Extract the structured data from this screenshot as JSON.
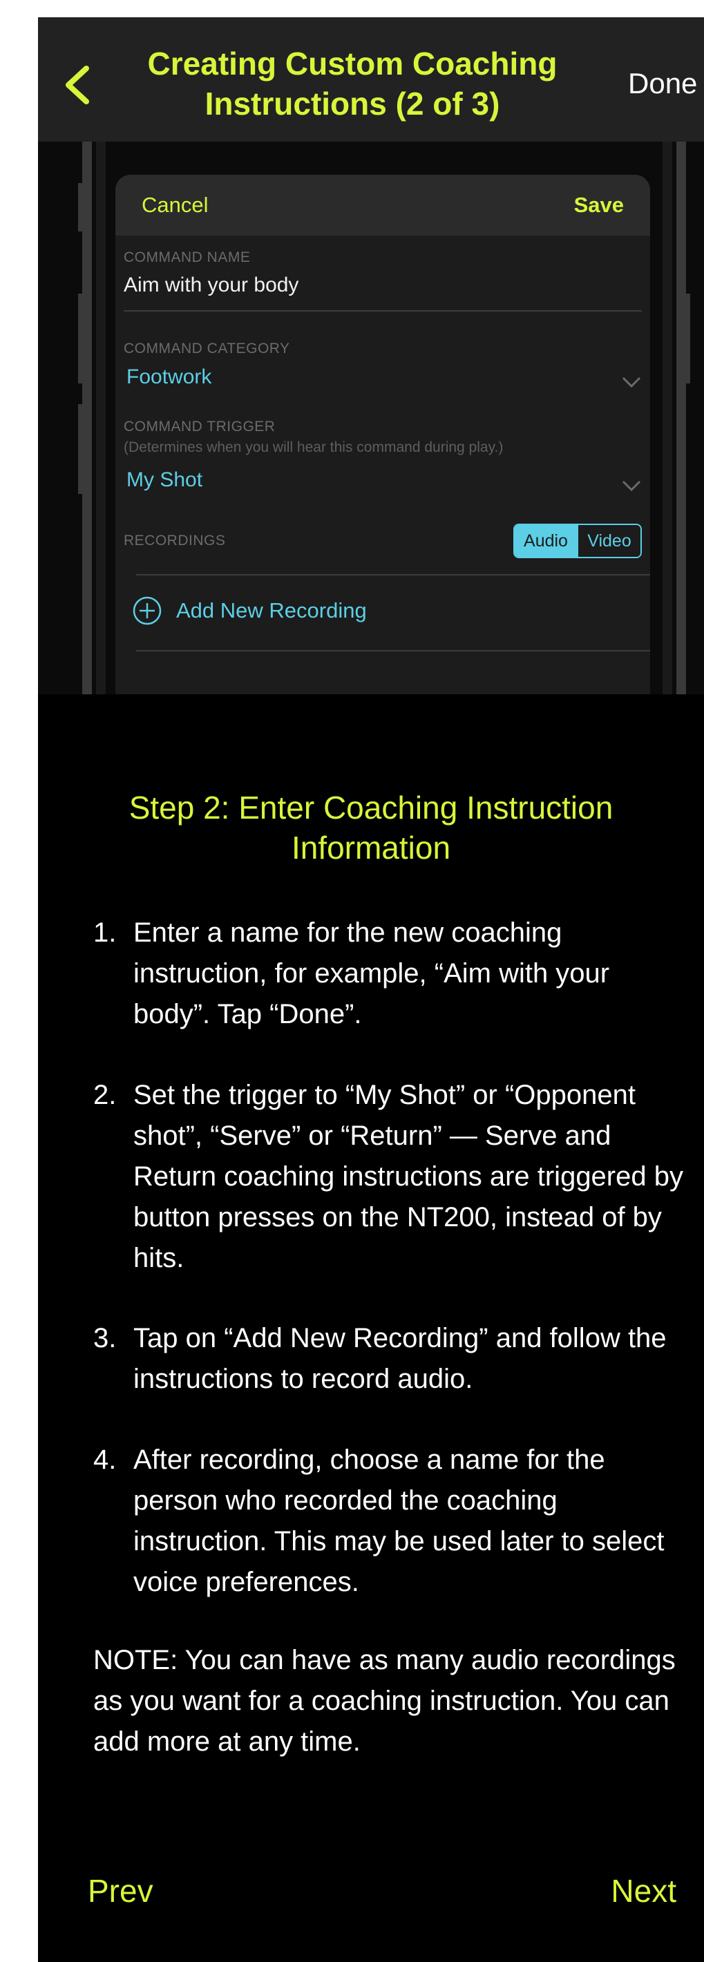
{
  "header": {
    "title": "Creating Custom Coaching Instructions (2 of 3)",
    "done_label": "Done",
    "back_icon": "chevron-left-icon"
  },
  "phone_form": {
    "cancel_label": "Cancel",
    "save_label": "Save",
    "command_name_label": "COMMAND NAME",
    "command_name_value": "Aim with your body",
    "command_category_label": "COMMAND CATEGORY",
    "command_category_value": "Footwork",
    "command_trigger_label": "COMMAND TRIGGER",
    "command_trigger_hint": "(Determines when you will hear this command during play.)",
    "command_trigger_value": "My Shot",
    "recordings_label": "RECORDINGS",
    "segment_audio": "Audio",
    "segment_video": "Video",
    "add_recording_label": "Add New Recording"
  },
  "instructions": {
    "step_title": "Step 2: Enter Coaching Instruction Information",
    "steps": [
      {
        "num": "1.",
        "text": "Enter a name for the new coaching instruction, for example, “Aim with your body”. Tap “Done”."
      },
      {
        "num": "2.",
        "text": "Set the trigger to “My Shot” or  “Opponent shot”, “Serve” or “Return” — Serve and Return coaching instructions are triggered by button presses on the NT200, instead of by hits."
      },
      {
        "num": "3.",
        "text": "Tap on “Add New Recording” and follow the instructions to record audio."
      },
      {
        "num": "4.",
        "text": "After recording, choose a name for the person who recorded the coaching instruction. This may be used later to select voice preferences."
      }
    ],
    "note": "NOTE:  You can have as many audio recordings as you want for a coaching instruction. You can add more at any time."
  },
  "footer": {
    "prev_label": "Prev",
    "next_label": "Next"
  },
  "colors": {
    "accent_yellow": "#d9f53a",
    "accent_blue": "#5ccfe6",
    "header_bg": "#222222",
    "background": "#000000"
  }
}
